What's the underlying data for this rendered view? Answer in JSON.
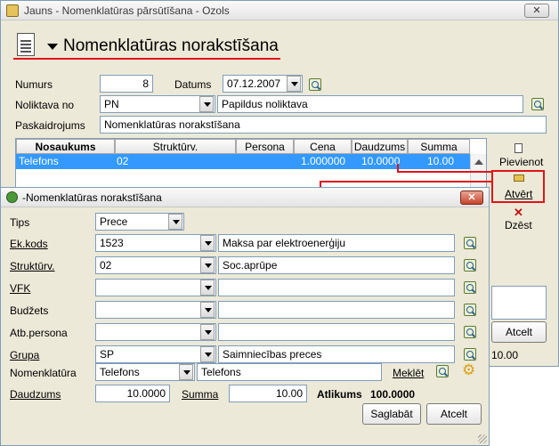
{
  "main_window": {
    "title": "Jauns - Nomenklatūras pārsūtīšana - Ozols",
    "heading": "Nomenklatūras norakstīšana",
    "fields": {
      "numurs_label": "Numurs",
      "numurs_value": "8",
      "datums_label": "Datums",
      "datums_value": "07.12.2007",
      "noliktava_label": "Noliktava no",
      "noliktava_code": "PN",
      "noliktava_name": "Papildus noliktava",
      "paskaidrojums_label": "Paskaidrojums",
      "paskaidrojums_value": "Nomenklatūras norakstīšana"
    },
    "grid": {
      "columns": [
        "Nosaukums",
        "Struktūrv.",
        "Persona",
        "Cena",
        "Daudzums",
        "Summa"
      ],
      "rows": [
        {
          "nosaukums": "Telefons",
          "strukturv": "02",
          "persona": "",
          "cena": "1.000000",
          "daudzums": "10.0000",
          "summa": "10.00"
        }
      ]
    },
    "actions": {
      "pievienot": "Pievienot",
      "atvert": "Atvērt",
      "dzest": "Dzēst",
      "atcelt": "Atcelt"
    },
    "summary_value": "10.00"
  },
  "dialog": {
    "title": "-Nomenklatūras norakstīšana",
    "tips_label": "Tips",
    "tips_value": "Prece",
    "rows": [
      {
        "label": "Ek.kods",
        "code": "1523",
        "name": "Maksa par elektroenerģiju"
      },
      {
        "label": "Struktūrv.",
        "code": "02",
        "name": "Soc.aprūpe"
      },
      {
        "label": "VFK",
        "code": "",
        "name": ""
      },
      {
        "label": "Budžets",
        "code": "",
        "name": ""
      },
      {
        "label": "Atb.persona",
        "code": "",
        "name": ""
      },
      {
        "label": "Grupa",
        "code": "SP",
        "name": "Saimniecības preces"
      }
    ],
    "nomenklatura_label": "Nomenklatūra",
    "nomenklatura_code": "Telefons",
    "nomenklatura_name": "Telefons",
    "mekleet_label": "Meklēt",
    "daudzums_label": "Daudzums",
    "daudzums_value": "10.0000",
    "summa_label": "Summa",
    "summa_value": "10.00",
    "atlikums_label": "Atlikums",
    "atlikums_value": "100.0000",
    "saglabat": "Saglabāt",
    "atcelt": "Atcelt"
  },
  "colors": {
    "accent_red": "#e0141b",
    "selection_blue": "#3399ff",
    "window_bg": "#ece9d8"
  }
}
